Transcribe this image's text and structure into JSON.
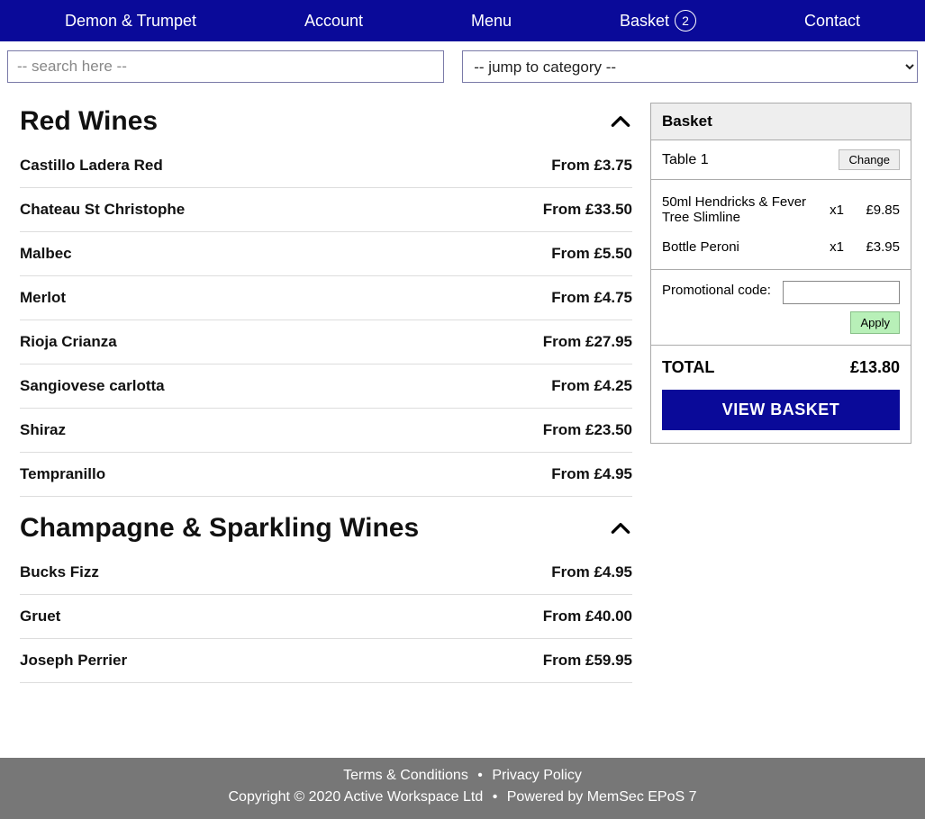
{
  "nav": {
    "brand": "Demon & Trumpet",
    "account": "Account",
    "menu": "Menu",
    "basket": "Basket",
    "basket_count": "2",
    "contact": "Contact"
  },
  "search": {
    "placeholder": "-- search here --"
  },
  "category_select": {
    "placeholder": "-- jump to category --"
  },
  "categories": [
    {
      "title": "Red Wines",
      "items": [
        {
          "name": "Castillo Ladera Red",
          "price": "From £3.75"
        },
        {
          "name": "Chateau St Christophe",
          "price": "From £33.50"
        },
        {
          "name": "Malbec",
          "price": "From £5.50"
        },
        {
          "name": "Merlot",
          "price": "From £4.75"
        },
        {
          "name": "Rioja Crianza",
          "price": "From £27.95"
        },
        {
          "name": "Sangiovese carlotta",
          "price": "From £4.25"
        },
        {
          "name": "Shiraz",
          "price": "From £23.50"
        },
        {
          "name": "Tempranillo",
          "price": "From £4.95"
        }
      ]
    },
    {
      "title": "Champagne & Sparkling Wines",
      "items": [
        {
          "name": "Bucks Fizz",
          "price": "From £4.95"
        },
        {
          "name": "Gruet",
          "price": "From £40.00"
        },
        {
          "name": "Joseph Perrier",
          "price": "From £59.95"
        }
      ]
    }
  ],
  "basket": {
    "header": "Basket",
    "table_label": "Table",
    "table_number": "1",
    "change_label": "Change",
    "items": [
      {
        "name": "50ml Hendricks & Fever Tree Slimline",
        "qty": "x1",
        "price": "£9.85"
      },
      {
        "name": "Bottle Peroni",
        "qty": "x1",
        "price": "£3.95"
      }
    ],
    "promo_label": "Promotional code:",
    "apply_label": "Apply",
    "total_label": "TOTAL",
    "total_value": "£13.80",
    "view_basket_label": "VIEW BASKET"
  },
  "footer": {
    "terms": "Terms & Conditions",
    "privacy": "Privacy Policy",
    "copyright": "Copyright © 2020 Active Workspace Ltd",
    "powered": "Powered by MemSec EPoS 7"
  }
}
